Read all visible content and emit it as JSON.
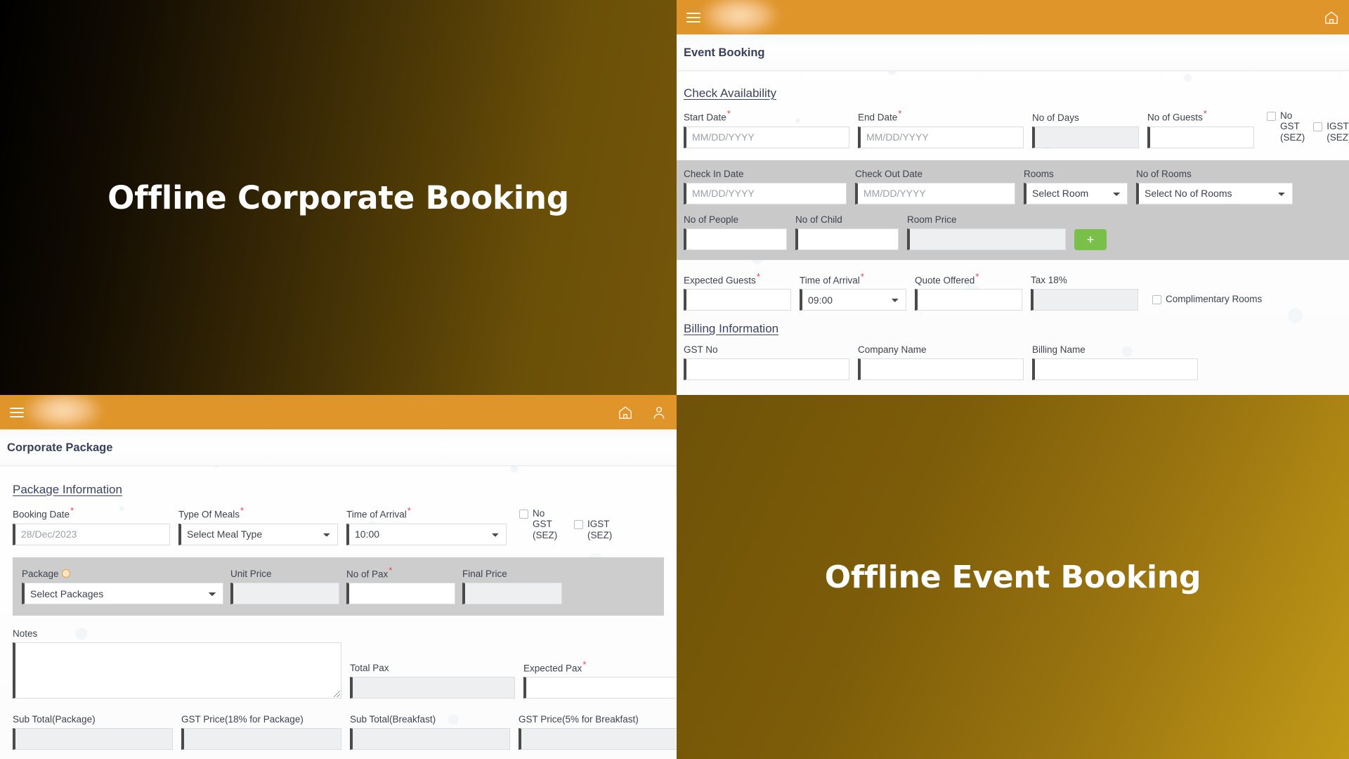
{
  "heroes": {
    "corporate": {
      "title": "Offline Corporate Booking"
    },
    "event": {
      "title": "Offline Event Booking"
    }
  },
  "event_panel": {
    "topbar": {
      "home_icon": "home-icon"
    },
    "card_title": "Event Booking",
    "check_availability": {
      "heading": "Check Availability"
    },
    "row1": {
      "start_date": {
        "label": "Start Date",
        "required": "*",
        "placeholder": "MM/DD/YYYY",
        "value": ""
      },
      "end_date": {
        "label": "End Date",
        "required": "*",
        "placeholder": "MM/DD/YYYY",
        "value": ""
      },
      "no_of_days": {
        "label": "No of Days",
        "value": ""
      },
      "no_of_guests": {
        "label": "No of Guests",
        "required": "*",
        "value": ""
      },
      "no_gst": {
        "line1": "No GST",
        "line2": "(SEZ)",
        "checked": false
      },
      "igst": {
        "line1": "IGST",
        "line2": "(SEZ)",
        "checked": false
      }
    },
    "rooms_band": {
      "check_in_date": {
        "label": "Check In Date",
        "placeholder": "MM/DD/YYYY",
        "value": ""
      },
      "check_out_date": {
        "label": "Check Out Date",
        "placeholder": "MM/DD/YYYY",
        "value": ""
      },
      "rooms": {
        "label": "Rooms",
        "selected": "Select Room"
      },
      "no_of_rooms": {
        "label": "No of Rooms",
        "selected": "Select No of Rooms"
      },
      "no_of_people": {
        "label": "No of People",
        "value": ""
      },
      "no_of_child": {
        "label": "No of Child",
        "value": ""
      },
      "room_price": {
        "label": "Room Price",
        "value": ""
      },
      "add_button": {
        "label": "+"
      }
    },
    "quote_row": {
      "expected_guests": {
        "label": "Expected Guests",
        "required": "*",
        "value": ""
      },
      "time_of_arrival": {
        "label": "Time of Arrival",
        "required": "*",
        "selected": "09:00"
      },
      "quote_offered": {
        "label": "Quote Offered",
        "required": "*",
        "value": ""
      },
      "tax": {
        "label": "Tax 18%",
        "value": ""
      },
      "complimentary_rooms": {
        "label": "Complimentary Rooms",
        "checked": false
      }
    },
    "billing": {
      "heading": "Billing Information",
      "gst_no": {
        "label": "GST No",
        "value": ""
      },
      "company_name": {
        "label": "Company Name",
        "value": ""
      },
      "billing_name": {
        "label": "Billing Name",
        "value": ""
      }
    }
  },
  "corporate_panel": {
    "topbar": {
      "home_icon": "home-icon",
      "user_icon": "user-icon"
    },
    "card_title": "Corporate Package",
    "package_information": {
      "heading": "Package Information"
    },
    "row1": {
      "booking_date": {
        "label": "Booking Date",
        "required": "*",
        "value": "28/Dec/2023"
      },
      "type_of_meals": {
        "label": "Type Of Meals",
        "required": "*",
        "selected": "Select Meal Type"
      },
      "time_of_arrival": {
        "label": "Time of Arrival",
        "required": "*",
        "selected": "10:00"
      },
      "no_gst": {
        "line1": "No GST",
        "line2": "(SEZ)",
        "checked": false
      },
      "igst": {
        "line1": "IGST",
        "line2": "(SEZ)",
        "checked": false
      }
    },
    "package_band": {
      "package": {
        "label": "Package",
        "help_icon": "help-circle-icon",
        "selected": "Select Packages"
      },
      "unit_price": {
        "label": "Unit Price",
        "value": ""
      },
      "no_of_pax": {
        "label": "No of Pax",
        "required": "*",
        "value": ""
      },
      "final_price": {
        "label": "Final Price",
        "value": ""
      }
    },
    "notes_row": {
      "notes": {
        "label": "Notes",
        "value": ""
      },
      "total_pax": {
        "label": "Total Pax",
        "value": ""
      },
      "expected_pax": {
        "label": "Expected Pax",
        "required": "*",
        "value": ""
      }
    },
    "totals_row": {
      "sub_total_package": {
        "label": "Sub Total(Package)",
        "value": ""
      },
      "gst_price_package": {
        "label": "GST Price(18% for Package)",
        "value": ""
      },
      "sub_total_breakfast": {
        "label": "Sub Total(Breakfast)",
        "value": ""
      },
      "gst_price_breakfast": {
        "label": "GST Price(5% for Breakfast)",
        "value": ""
      }
    }
  },
  "colors": {
    "brand_orange": "#e0952b",
    "add_green": "#79bf4a",
    "required_red": "#e8414a",
    "gray_band": "#c9c9c9",
    "title_navy": "#37405c"
  }
}
